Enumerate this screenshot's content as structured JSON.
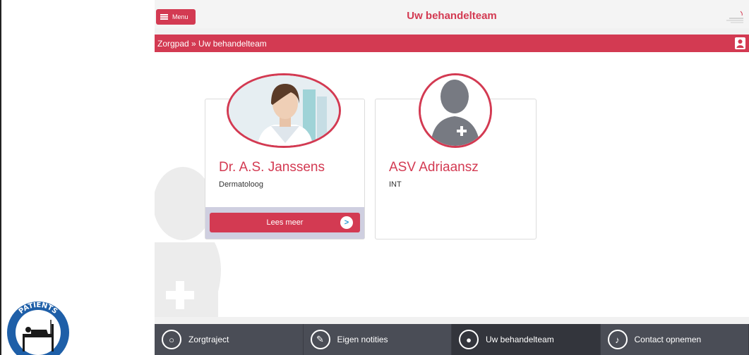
{
  "header": {
    "menu_label": "Menu",
    "title": "Uw behandelteam"
  },
  "breadcrumb": "Zorgpad » Uw behandelteam",
  "team": [
    {
      "name": "Dr. A.S. Janssens",
      "role": "Dermatoloog",
      "button": "Lees meer",
      "button_icon": ">"
    },
    {
      "name": "ASV Adriaansz",
      "role": "INT"
    }
  ],
  "bottom_nav": [
    {
      "label": "Zorgtraject",
      "icon": "route-icon"
    },
    {
      "label": "Eigen notities",
      "icon": "pencil-icon"
    },
    {
      "label": "Uw behandelteam",
      "icon": "person-icon"
    },
    {
      "label": "Contact opnemen",
      "icon": "bell-icon"
    }
  ],
  "badge": {
    "text": "PATIENTS",
    "icon": "patient-bed-icon"
  },
  "colors": {
    "accent": "#d33a52",
    "nav_bg": "#4a4d56",
    "nav_active": "#33353c"
  }
}
